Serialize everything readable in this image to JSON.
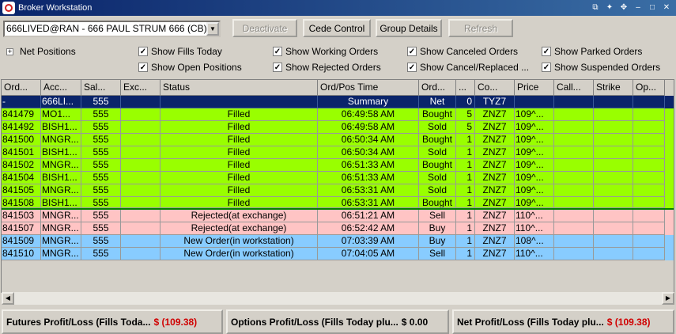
{
  "window": {
    "title": "Broker Workstation"
  },
  "toolbar": {
    "account_select": "666LIVED@RAN - 666 PAUL STRUM 666 (CB)",
    "deactivate": "Deactivate",
    "cede_control": "Cede Control",
    "group_details": "Group Details",
    "refresh": "Refresh"
  },
  "options": {
    "net_positions": "Net Positions",
    "show_fills_today": "Show Fills Today",
    "show_open_positions": "Show Open Positions",
    "show_working_orders": "Show Working Orders",
    "show_rejected_orders": "Show Rejected Orders",
    "show_canceled_orders": "Show Canceled Orders",
    "show_cancel_replaced": "Show Cancel/Replaced ...",
    "show_parked_orders": "Show Parked Orders",
    "show_suspended_orders": "Show Suspended Orders"
  },
  "columns": [
    "Ord...",
    "Acc...",
    "Sal...",
    "Exc...",
    "Status",
    "Ord/Pos Time",
    "Ord...",
    "...",
    "Co...",
    "Price",
    "Call...",
    "Strike",
    "Op..."
  ],
  "rows": [
    {
      "type": "summary",
      "cells": [
        "-",
        "666LI...",
        "555",
        "",
        "",
        "Summary",
        "Net",
        "0",
        "TYZ7",
        "",
        "",
        "",
        ""
      ]
    },
    {
      "type": "filled",
      "cells": [
        "841479",
        "MO1...",
        "555",
        "",
        "Filled",
        "06:49:58 AM",
        "Bought",
        "5",
        "ZNZ7",
        "109^...",
        "",
        "",
        ""
      ]
    },
    {
      "type": "filled",
      "cells": [
        "841492",
        "BISH1...",
        "555",
        "",
        "Filled",
        "06:49:58 AM",
        "Sold",
        "5",
        "ZNZ7",
        "109^...",
        "",
        "",
        ""
      ]
    },
    {
      "type": "filled",
      "cells": [
        "841500",
        "MNGR...",
        "555",
        "",
        "Filled",
        "06:50:34 AM",
        "Bought",
        "1",
        "ZNZ7",
        "109^...",
        "",
        "",
        ""
      ]
    },
    {
      "type": "filled",
      "cells": [
        "841501",
        "BISH1...",
        "555",
        "",
        "Filled",
        "06:50:34 AM",
        "Sold",
        "1",
        "ZNZ7",
        "109^...",
        "",
        "",
        ""
      ]
    },
    {
      "type": "filled",
      "cells": [
        "841502",
        "MNGR...",
        "555",
        "",
        "Filled",
        "06:51:33 AM",
        "Bought",
        "1",
        "ZNZ7",
        "109^...",
        "",
        "",
        ""
      ]
    },
    {
      "type": "filled",
      "cells": [
        "841504",
        "BISH1...",
        "555",
        "",
        "Filled",
        "06:51:33 AM",
        "Sold",
        "1",
        "ZNZ7",
        "109^...",
        "",
        "",
        ""
      ]
    },
    {
      "type": "filled",
      "cells": [
        "841505",
        "MNGR...",
        "555",
        "",
        "Filled",
        "06:53:31 AM",
        "Sold",
        "1",
        "ZNZ7",
        "109^...",
        "",
        "",
        ""
      ]
    },
    {
      "type": "filled",
      "cells": [
        "841508",
        "BISH1...",
        "555",
        "",
        "Filled",
        "06:53:31 AM",
        "Bought",
        "1",
        "ZNZ7",
        "109^...",
        "",
        "",
        ""
      ]
    },
    {
      "type": "rejected",
      "cells": [
        "841503",
        "MNGR...",
        "555",
        "",
        "Rejected(at exchange)",
        "06:51:21 AM",
        "Sell",
        "1",
        "ZNZ7",
        "110^...",
        "",
        "",
        ""
      ]
    },
    {
      "type": "rejected",
      "cells": [
        "841507",
        "MNGR...",
        "555",
        "",
        "Rejected(at exchange)",
        "06:52:42 AM",
        "Buy",
        "1",
        "ZNZ7",
        "110^...",
        "",
        "",
        ""
      ]
    },
    {
      "type": "neworder",
      "cells": [
        "841509",
        "MNGR...",
        "555",
        "",
        "New Order(in workstation)",
        "07:03:39 AM",
        "Buy",
        "1",
        "ZNZ7",
        "108^...",
        "",
        "",
        ""
      ]
    },
    {
      "type": "neworder",
      "cells": [
        "841510",
        "MNGR...",
        "555",
        "",
        "New Order(in workstation)",
        "07:04:05 AM",
        "Sell",
        "1",
        "ZNZ7",
        "110^...",
        "",
        "",
        ""
      ]
    }
  ],
  "status": {
    "futures_label": "Futures Profit/Loss (Fills Toda...",
    "futures_value": "$ (109.38)",
    "options_label": "Options Profit/Loss (Fills Today plu...",
    "options_value": "$ 0.00",
    "net_label": "Net Profit/Loss (Fills Today plu...",
    "net_value": "$ (109.38)"
  },
  "colors": {
    "filled": "#99ff00",
    "rejected": "#ffc4c4",
    "new_order": "#88ccff",
    "summary": "#0a246a",
    "loss": "#d00000"
  },
  "icons": [
    "app-icon",
    "restore-icon",
    "pin-icon",
    "move-icon",
    "minimize-icon",
    "maximize-icon",
    "close-icon"
  ]
}
